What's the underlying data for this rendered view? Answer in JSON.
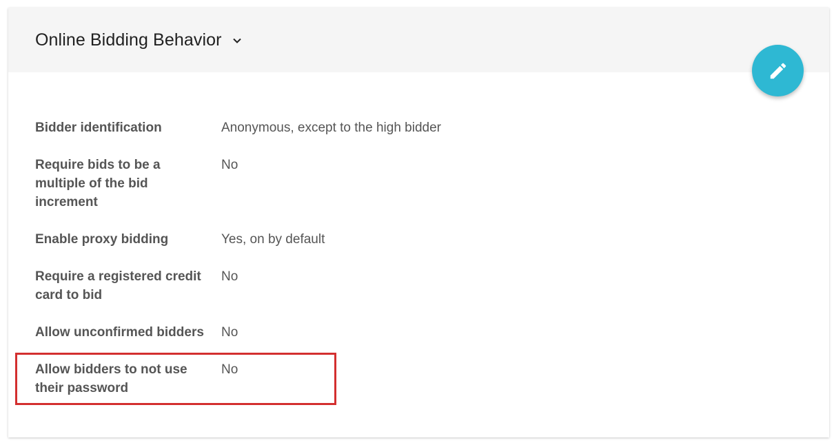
{
  "section": {
    "title": "Online Bidding Behavior",
    "edit_icon": "pencil-icon",
    "expand_icon": "chevron-down-icon",
    "accent_color": "#2eb8d3",
    "highlight_color": "#d32f2f"
  },
  "settings": [
    {
      "label": "Bidder identification",
      "value": "Anonymous, except to the high bidder"
    },
    {
      "label": "Require bids to be a multiple of the bid increment",
      "value": "No"
    },
    {
      "label": "Enable proxy bidding",
      "value": "Yes, on by default"
    },
    {
      "label": "Require a registered credit card to bid",
      "value": "No"
    },
    {
      "label": "Allow unconfirmed bidders",
      "value": "No"
    },
    {
      "label": "Allow bidders to not use their password",
      "value": "No"
    }
  ]
}
